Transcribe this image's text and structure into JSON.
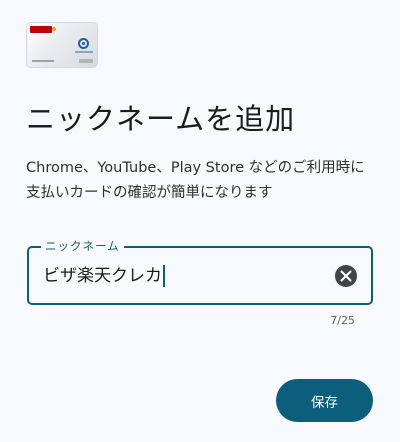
{
  "card": {
    "brand_color": "#bf0000"
  },
  "page": {
    "title": "ニックネームを追加",
    "description": "Chrome、YouTube、Play Store などのご利用時に支払いカードの確認が簡単になります"
  },
  "nickname_field": {
    "label": "ニックネーム",
    "value": "ビザ楽天クレカ",
    "counter": "7/25",
    "accent_color": "#0b5f7d"
  },
  "actions": {
    "save_label": "保存",
    "clear_icon": "close-icon"
  }
}
